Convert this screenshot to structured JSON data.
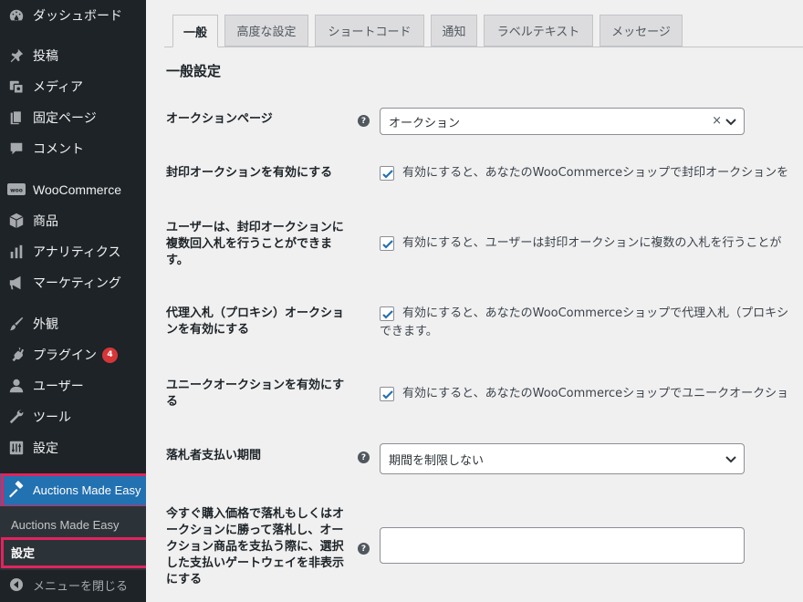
{
  "sidebar": {
    "items": [
      {
        "label": "ダッシュボード",
        "icon": "dashboard-icon"
      },
      {
        "label": "投稿",
        "icon": "pin-icon"
      },
      {
        "label": "メディア",
        "icon": "media-icon"
      },
      {
        "label": "固定ページ",
        "icon": "page-icon"
      },
      {
        "label": "コメント",
        "icon": "comment-icon"
      },
      {
        "label": "WooCommerce",
        "icon": "woo-icon"
      },
      {
        "label": "商品",
        "icon": "box-icon"
      },
      {
        "label": "アナリティクス",
        "icon": "bar-chart-icon"
      },
      {
        "label": "マーケティング",
        "icon": "megaphone-icon"
      },
      {
        "label": "外観",
        "icon": "brush-icon"
      },
      {
        "label": "プラグイン",
        "icon": "plugin-icon",
        "badge": "4"
      },
      {
        "label": "ユーザー",
        "icon": "user-icon"
      },
      {
        "label": "ツール",
        "icon": "wrench-icon"
      },
      {
        "label": "設定",
        "icon": "settings-icon"
      }
    ],
    "active": {
      "label": "Auctions Made Easy",
      "icon": "gavel-icon"
    },
    "submenu": [
      "Auctions Made Easy",
      "設定"
    ],
    "collapse": "メニューを閉じる"
  },
  "tabs": [
    "一般",
    "高度な設定",
    "ショートコード",
    "通知",
    "ラベルテキスト",
    "メッセージ"
  ],
  "section_title": "一般設定",
  "fields": {
    "auction_page": {
      "label": "オークションページ",
      "value": "オークション",
      "clear": "×"
    },
    "sealed": {
      "label": "封印オークションを有効にする",
      "desc": "有効にすると、あなたのWooCommerceショップで封印オークションを"
    },
    "multi_bid": {
      "label": "ユーザーは、封印オークションに複数回入札を行うことができます。",
      "desc": "有効にすると、ユーザーは封印オークションに複数の入札を行うことが"
    },
    "proxy": {
      "label": "代理入札（プロキシ）オークションを有効にする",
      "desc": "有効にすると、あなたのWooCommerceショップで代理入札（プロキシ",
      "desc2": "できます。"
    },
    "unique": {
      "label": "ユニークオークションを有効にする",
      "desc": "有効にすると、あなたのWooCommerceショップでユニークオークショ"
    },
    "payment_period": {
      "label": "落札者支払い期間",
      "value": "期間を制限しない"
    },
    "hide_gateway": {
      "label": "今すぐ購入価格で落札もしくはオークションに勝って落札し、オークション商品を支払う際に、選択した支払いゲートウェイを非表示にする",
      "value": ""
    }
  },
  "colors": {
    "sidebar": "#1d2327",
    "active": "#2271b1",
    "highlight": "#e0245e",
    "badge": "#d63638"
  }
}
